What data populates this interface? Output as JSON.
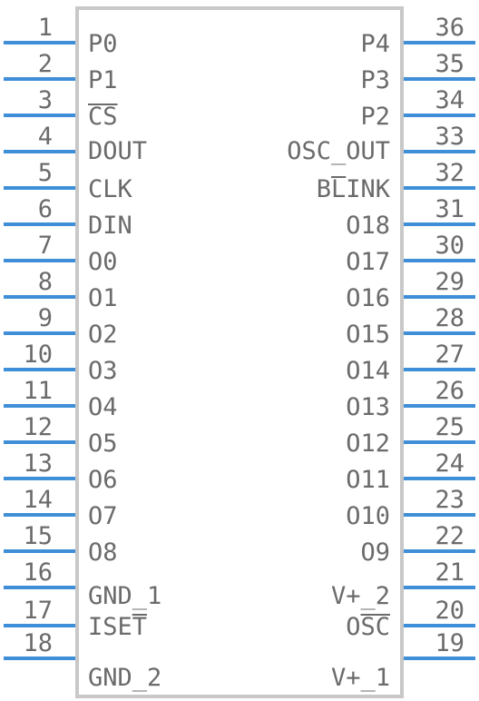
{
  "left_pins": [
    {
      "num": "1",
      "label": "P0"
    },
    {
      "num": "2",
      "label": "P1"
    },
    {
      "num": "3",
      "label": "CS"
    },
    {
      "num": "4",
      "label": "DOUT"
    },
    {
      "num": "5",
      "label": "CLK"
    },
    {
      "num": "6",
      "label": "DIN"
    },
    {
      "num": "7",
      "label": "O0"
    },
    {
      "num": "8",
      "label": "O1"
    },
    {
      "num": "9",
      "label": "O2"
    },
    {
      "num": "10",
      "label": "O3"
    },
    {
      "num": "11",
      "label": "O4"
    },
    {
      "num": "12",
      "label": "O5"
    },
    {
      "num": "13",
      "label": "O6"
    },
    {
      "num": "14",
      "label": "O7"
    },
    {
      "num": "15",
      "label": "O8"
    },
    {
      "num": "16",
      "label": "GND_1"
    },
    {
      "num": "17",
      "label": "ISET"
    },
    {
      "num": "18",
      "label": "GND_2"
    }
  ],
  "right_pins": [
    {
      "num": "36",
      "label": "P4"
    },
    {
      "num": "35",
      "label": "P3"
    },
    {
      "num": "34",
      "label": "P2"
    },
    {
      "num": "33",
      "label": "OSC_OUT"
    },
    {
      "num": "32",
      "label": "BLINK"
    },
    {
      "num": "31",
      "label": "O18"
    },
    {
      "num": "30",
      "label": "O17"
    },
    {
      "num": "29",
      "label": "O16"
    },
    {
      "num": "28",
      "label": "O15"
    },
    {
      "num": "27",
      "label": "O14"
    },
    {
      "num": "26",
      "label": "O13"
    },
    {
      "num": "25",
      "label": "O12"
    },
    {
      "num": "24",
      "label": "O11"
    },
    {
      "num": "23",
      "label": "O10"
    },
    {
      "num": "22",
      "label": "O9"
    },
    {
      "num": "21",
      "label": "V+_2"
    },
    {
      "num": "20",
      "label": "OSC"
    },
    {
      "num": "19",
      "label": "V+_1"
    }
  ],
  "colors": {
    "pin": "#3f8fd8",
    "body_outline": "#c8c8c8",
    "text": "#6b6b6b"
  }
}
